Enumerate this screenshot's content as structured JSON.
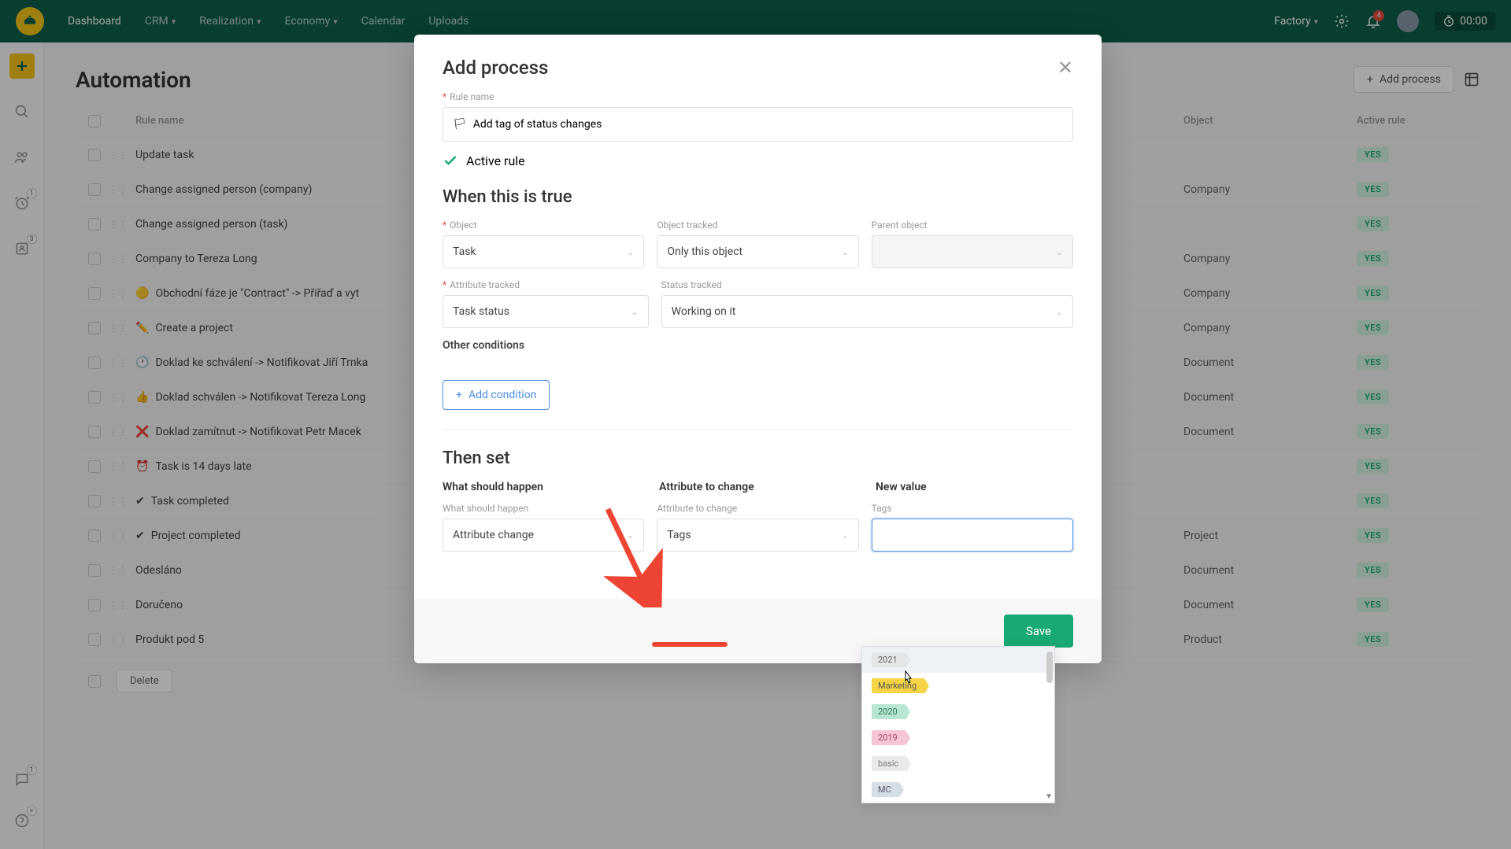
{
  "nav": {
    "items": [
      "Dashboard",
      "CRM",
      "Realization",
      "Economy",
      "Calendar",
      "Uploads"
    ],
    "factory": "Factory",
    "bell_badge": "4",
    "timer": "00:00"
  },
  "leftbar": {
    "alarm_badge": "1",
    "people_badge": "3",
    "chat_badge": "1",
    "arrow_badge": ">"
  },
  "page": {
    "title": "Automation",
    "add_process": "Add process"
  },
  "table": {
    "headers": {
      "rule": "Rule name",
      "object": "Object",
      "active": "Active rule"
    },
    "rows": [
      {
        "icon": "",
        "name": "Update task",
        "object": "",
        "yes": "YES"
      },
      {
        "icon": "",
        "name": "Change assigned person (company)",
        "object": "Company",
        "yes": "YES"
      },
      {
        "icon": "",
        "name": "Change assigned person (task)",
        "object": "",
        "yes": "YES"
      },
      {
        "icon": "",
        "name": "Company to Tereza Long",
        "object": "Company",
        "yes": "YES"
      },
      {
        "icon": "🟡",
        "name": "Obchodní fáze je \"Contract\" -> Přiřaď a vyt",
        "object": "Company",
        "yes": "YES"
      },
      {
        "icon": "✏️",
        "name": "Create a project",
        "object": "Company",
        "yes": "YES"
      },
      {
        "icon": "🕐",
        "name": "Doklad ke schválení -> Notifikovat Jiří Trnka",
        "object": "Document",
        "yes": "YES"
      },
      {
        "icon": "👍",
        "name": "Doklad schválen -> Notifikovat Tereza Long",
        "object": "Document",
        "yes": "YES"
      },
      {
        "icon": "❌",
        "name": "Doklad zamítnut -> Notifikovat Petr Macek",
        "object": "Document",
        "yes": "YES"
      },
      {
        "icon": "⏰",
        "name": "Task is 14 days late",
        "object": "",
        "yes": "YES"
      },
      {
        "icon": "✔",
        "name": "Task completed",
        "object": "",
        "yes": "YES"
      },
      {
        "icon": "✔",
        "name": "Project completed",
        "object": "Project",
        "yes": "YES"
      },
      {
        "icon": "",
        "name": "Odesláno",
        "object": "Document",
        "yes": "YES"
      },
      {
        "icon": "",
        "name": "Doručeno",
        "object": "Document",
        "yes": "YES"
      },
      {
        "icon": "",
        "name": "Produkt pod 5",
        "object": "Product",
        "yes": "YES"
      }
    ],
    "delete": "Delete"
  },
  "modal": {
    "title": "Add process",
    "rule_name_label": "Rule name",
    "rule_name_value": "Add tag of status changes",
    "active_rule": "Active rule",
    "when_title": "When this is true",
    "object_label": "Object",
    "object_value": "Task",
    "object_tracked_label": "Object tracked",
    "object_tracked_value": "Only this object",
    "parent_object_label": "Parent object",
    "attribute_tracked_label": "Attribute tracked",
    "attribute_tracked_value": "Task status",
    "status_tracked_label": "Status tracked",
    "status_tracked_value": "Working on it",
    "other_conditions": "Other conditions",
    "add_condition": "Add condition",
    "then_title": "Then set",
    "col_what": "What should happen",
    "col_attr": "Attribute to change",
    "col_new": "New value",
    "what_label": "What should happen",
    "what_value": "Attribute change",
    "attr_label": "Attribute to change",
    "attr_value": "Tags",
    "tags_label": "Tags",
    "save": "Save"
  },
  "dropdown": {
    "items": [
      {
        "label": "2021",
        "cls": "tag-gray",
        "highlighted": true
      },
      {
        "label": "Marketing",
        "cls": "tag-yellow"
      },
      {
        "label": "2020",
        "cls": "tag-green"
      },
      {
        "label": "2019",
        "cls": "tag-pink"
      },
      {
        "label": "basic",
        "cls": "tag-lightgray"
      },
      {
        "label": "MC",
        "cls": "tag-bluegray"
      }
    ]
  }
}
